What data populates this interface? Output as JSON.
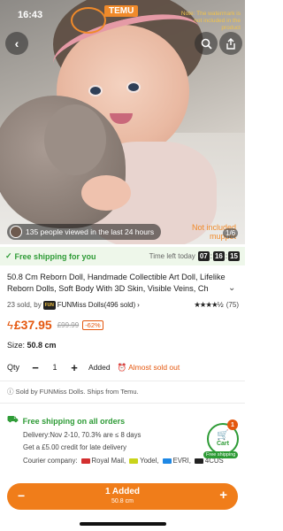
{
  "status_bar": {
    "time": "16:43"
  },
  "hero": {
    "overlay_brand": "TEMU",
    "overlay_watermark": "Note: The watermark is not included in the product",
    "overlay_not_included": "Not included muppet",
    "viewed_text": "135 people viewed in the last 24 hours",
    "image_counter": "1/6",
    "icons": {
      "back": "chevron-left-icon",
      "search": "search-icon",
      "share": "share-icon"
    }
  },
  "shipping_bar": {
    "free_label": "Free shipping for you",
    "timer_label": "Time left today",
    "hours": "07",
    "minutes": "16",
    "seconds": "15"
  },
  "product": {
    "title": "50.8 Cm Reborn Doll, Handmade Collectible Art Doll, Lifelike Reborn Dolls, Soft Body With 3D Skin, Visible Veins, Ch",
    "sold_count": "23 sold, by",
    "store_logo": "FUN",
    "store_name": "FUNMiss Dolls(496 sold)",
    "store_chevron": "›",
    "stars": "★★★★½",
    "rating_count": "(75)",
    "price": "£37.95",
    "old_price": "£99.99",
    "discount": "-62%",
    "size_label": "Size:",
    "size_value": "50.8 cm",
    "qty_label": "Qty",
    "qty_value": "1",
    "added_text": "Added",
    "almost_sold_out": "Almost sold out"
  },
  "sold_by": "ⓘ Sold by FUNMiss Dolls. Ships from Temu.",
  "shipping_info": {
    "title": "Free shipping on all orders",
    "delivery": "Delivery:Nov 2-10, 70.3% are ≤ 8 days",
    "credit": "Get a £5.00 credit for late delivery",
    "courier_label": "Courier company:",
    "couriers": [
      "Royal Mail,",
      "Yodel,",
      "EVRI,",
      "4CUS"
    ],
    "courier_colors": [
      "#d32f2f",
      "#c9d41a",
      "#1e88e5",
      "#222222"
    ]
  },
  "cart": {
    "label": "Cart",
    "badge": "1",
    "free_tag": "Free shipping"
  },
  "bottom": {
    "line1": "1 Added",
    "line2": "50.8 cm",
    "minus": "−",
    "plus": "+"
  },
  "colors": {
    "accent": "#f07d1a",
    "price": "#e4570e",
    "green": "#2e9b36"
  }
}
